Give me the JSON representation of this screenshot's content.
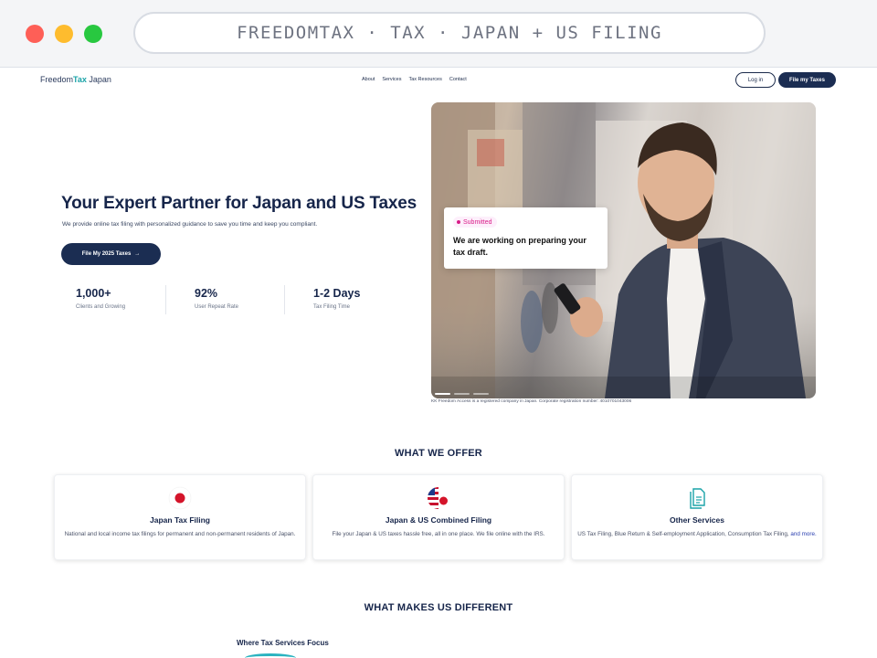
{
  "browser": {
    "url_text": "FREEDOMTAX · TAX · JAPAN + US FILING"
  },
  "nav": {
    "logo_primary": "Freedom",
    "logo_accent": "Tax",
    "logo_suffix": " Japan",
    "links": [
      "About",
      "Services",
      "Tax Resources",
      "Contact"
    ],
    "login_label": "Log in",
    "file_label": "File my Taxes"
  },
  "hero": {
    "title": "Your Expert Partner for Japan and US Taxes",
    "subtitle": "We provide online tax filing with personalized guidance to save you time and keep you compliant.",
    "cta_label": "File My 2025 Taxes",
    "cta_arrow": "→",
    "stats": [
      {
        "value": "1,000+",
        "label": "Clients and Growing"
      },
      {
        "value": "92%",
        "label": "User Repeat Rate"
      },
      {
        "value": "1-2 Days",
        "label": "Tax Filing Time"
      }
    ],
    "status_badge": "Submitted",
    "status_message": "We are working on preparing your tax draft.",
    "registration_note": "KK Freedom Access is a registered company in Japan. Corporate registration number: 4010701043006",
    "carousel_active_index": 0,
    "carousel_count": 3
  },
  "offer": {
    "heading": "WHAT WE OFFER",
    "cards": [
      {
        "icon": "japan-flag-icon",
        "title": "Japan Tax Filing",
        "desc": "National and local income tax filings for permanent and non-permanent residents of Japan.",
        "more": ""
      },
      {
        "icon": "us-japan-flag-icon",
        "title": "Japan & US Combined Filing",
        "desc": "File your Japan & US taxes hassle free, all in one place. We file online with the IRS.",
        "more": ""
      },
      {
        "icon": "documents-icon",
        "title": "Other Services",
        "desc": "US Tax Filing, Blue Return & Self-employment Application, Consumption Tax Filing, ",
        "more": "and more."
      }
    ]
  },
  "different": {
    "heading": "WHAT MAKES US DIFFERENT",
    "focus_label": "Where Tax Services Focus"
  },
  "colors": {
    "navy": "#1b2d52",
    "teal_accent": "#1aa3a8",
    "badge_pink": "#d81b87",
    "link_blue": "#2a3fb0"
  }
}
